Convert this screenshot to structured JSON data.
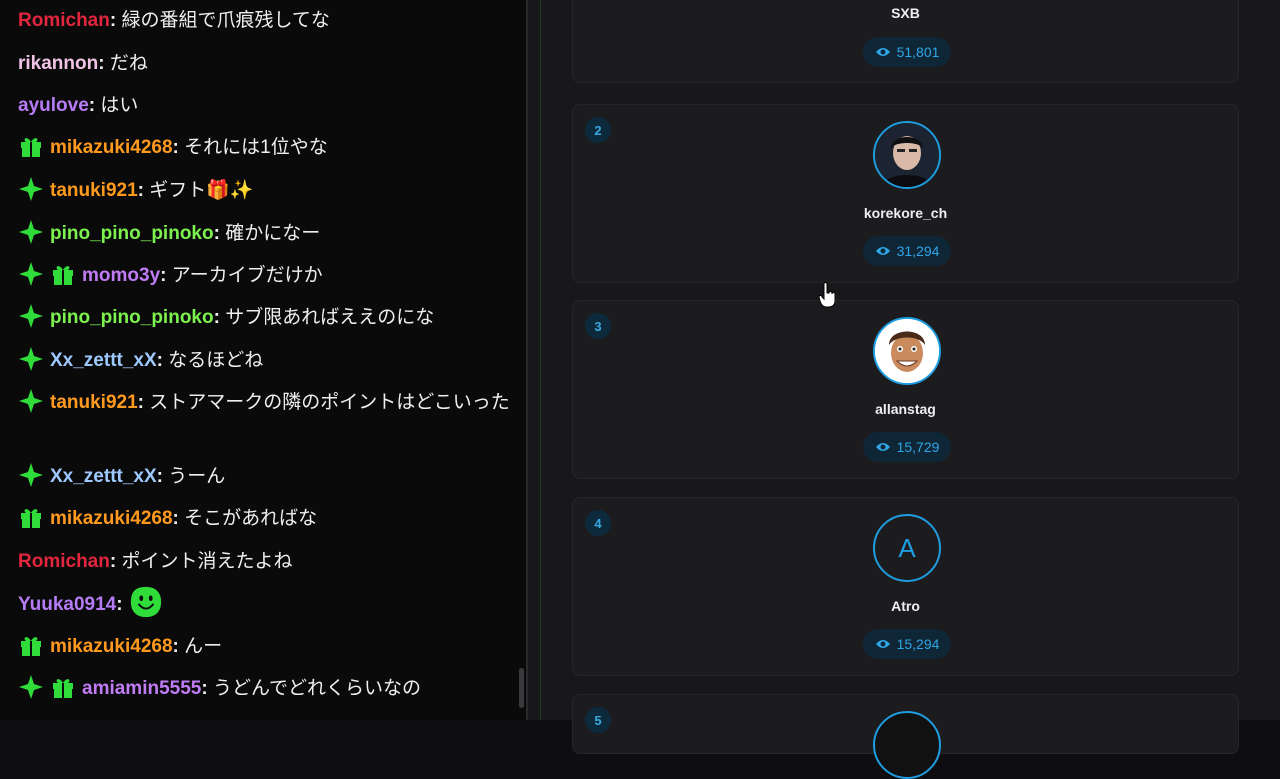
{
  "chat": {
    "messages": [
      {
        "user": "Romichan",
        "color": "#e3263d",
        "badges": [],
        "text": "緑の番組で爪痕残してな"
      },
      {
        "user": "rikannon",
        "color": "#f1c4e6",
        "badges": [],
        "text": "だね"
      },
      {
        "user": "ayulove",
        "color": "#b67cf5",
        "badges": [],
        "text": "はい"
      },
      {
        "user": "mikazuki4268",
        "color": "#ff9a1f",
        "badges": [
          "gift-icon"
        ],
        "text": "それには1位やな"
      },
      {
        "user": "tanuki921",
        "color": "#ff9a1f",
        "badges": [
          "sparkle-icon"
        ],
        "text": "ギフト🎁✨"
      },
      {
        "user": "pino_pino_pinoko",
        "color": "#7cf24f",
        "badges": [
          "sparkle-icon"
        ],
        "text": "確かになー"
      },
      {
        "user": "momo3y",
        "color": "#c07cf5",
        "badges": [
          "sparkle-icon",
          "gift-icon"
        ],
        "text": "アーカイブだけか"
      },
      {
        "user": "pino_pino_pinoko",
        "color": "#7cf24f",
        "badges": [
          "sparkle-icon"
        ],
        "text": "サブ限あればええのにな"
      },
      {
        "user": "Xx_zettt_xX",
        "color": "#9ec9ff",
        "badges": [
          "sparkle-icon"
        ],
        "text": "なるほどね"
      },
      {
        "user": "tanuki921",
        "color": "#ff9a1f",
        "badges": [
          "sparkle-icon"
        ],
        "text": "ストアマークの隣のポイントはどこいった"
      },
      {
        "user": "Xx_zettt_xX",
        "color": "#9ec9ff",
        "badges": [
          "sparkle-icon"
        ],
        "text": "うーん"
      },
      {
        "user": "mikazuki4268",
        "color": "#ff9a1f",
        "badges": [
          "gift-icon"
        ],
        "text": "そこがあればな"
      },
      {
        "user": "Romichan",
        "color": "#e3263d",
        "badges": [],
        "text": "ポイント消えたよね"
      },
      {
        "user": "Yuuka0914",
        "color": "#b67cf5",
        "badges": [],
        "text": "",
        "emote": "green-smile-emote"
      },
      {
        "user": "mikazuki4268",
        "color": "#ff9a1f",
        "badges": [
          "gift-icon"
        ],
        "text": "んー"
      },
      {
        "user": "amiamin5555",
        "color": "#c07cf5",
        "badges": [
          "sparkle-icon",
          "gift-icon"
        ],
        "text": "うどんでどれくらいなの"
      }
    ]
  },
  "leaderboard": {
    "accent": "#1e9de0",
    "entries": [
      {
        "rank": "",
        "name": "SXB",
        "views": "51,801"
      },
      {
        "rank": "2",
        "name": "korekore_ch",
        "views": "31,294",
        "avatar": "person-avatar"
      },
      {
        "rank": "3",
        "name": "allanstag",
        "views": "15,729",
        "avatar": "cartoon-avatar"
      },
      {
        "rank": "4",
        "name": "Atro",
        "views": "15,294",
        "avatar_letter": "A"
      },
      {
        "rank": "5",
        "name": "",
        "views": ""
      }
    ]
  }
}
